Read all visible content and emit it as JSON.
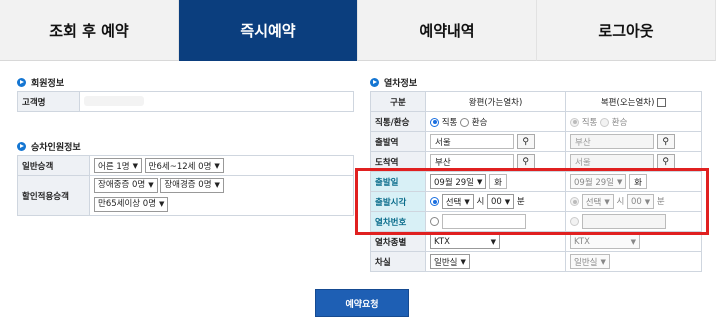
{
  "tabs": [
    "조회 후 예약",
    "즉시예약",
    "예약내역",
    "로그아웃"
  ],
  "member": {
    "title": "회원정보",
    "label": "고객명"
  },
  "passenger": {
    "title": "승차인원정보",
    "general_label": "일반승객",
    "adult": "어른 1명",
    "child": "만6세~12세 0명",
    "discount_label": "할인적용승객",
    "disabled_severe": "장애중증 0명",
    "disabled_mild": "장애경증 0명",
    "senior": "만65세이상 0명"
  },
  "train": {
    "title": "열차정보",
    "col_label": "구분",
    "col_out": "왕편(가는열차)",
    "col_ret": "복편(오는열차)",
    "row_type": "직통/환승",
    "direct": "직통",
    "transfer": "환승",
    "row_dep": "출발역",
    "row_arr": "도착역",
    "out_dep": "서울",
    "out_arr": "부산",
    "ret_dep": "부산",
    "ret_arr": "서울",
    "row_date": "출발일",
    "out_date": "09월 29일",
    "out_day": "화",
    "ret_date": "09월 29일",
    "ret_day": "화",
    "row_time": "출발시각",
    "time_select": "선택",
    "hour_unit": "시",
    "min_value": "00",
    "min_unit": "분",
    "row_trainno": "열차번호",
    "row_kind": "열차종별",
    "kind": "KTX",
    "row_class": "차실",
    "class": "일반실"
  },
  "submit": "예약요청",
  "colors": {
    "tab_active": "#0b3e7e",
    "highlight": "#e02020",
    "button": "#1e5fb4"
  }
}
